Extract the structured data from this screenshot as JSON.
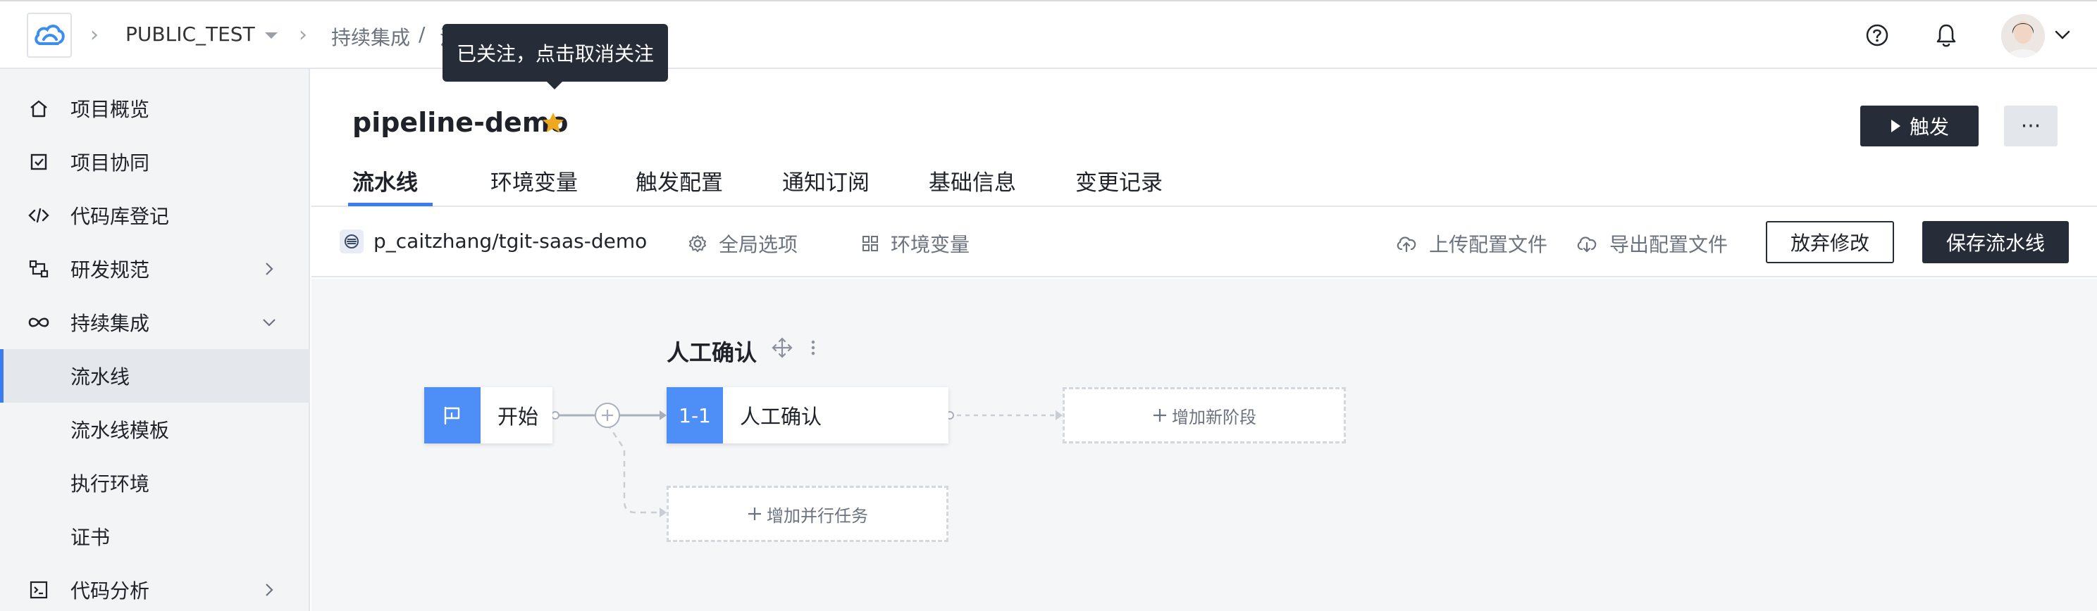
{
  "header": {
    "project": "PUBLIC_TEST",
    "breadcrumb_section": "持续集成",
    "breadcrumb_sep": "/",
    "breadcrumb_current": "流",
    "tooltip": "已关注，点击取消关注",
    "icons": [
      "help-icon",
      "bell-icon",
      "avatar",
      "chevron-down-icon"
    ]
  },
  "sidebar": {
    "items": [
      {
        "label": "项目概览",
        "icon": "home-icon"
      },
      {
        "label": "项目协同",
        "icon": "checkbox-icon"
      },
      {
        "label": "代码库登记",
        "icon": "code-icon"
      },
      {
        "label": "研发规范",
        "icon": "flow-icon",
        "expandable": true
      },
      {
        "label": "持续集成",
        "icon": "infinity-icon",
        "expanded": true
      },
      {
        "label": "流水线",
        "active": true
      },
      {
        "label": "流水线模板"
      },
      {
        "label": "执行环境"
      },
      {
        "label": "证书"
      },
      {
        "label": "代码分析",
        "icon": "terminal-icon",
        "expandable": true
      }
    ]
  },
  "pipeline": {
    "name": "pipeline-demo",
    "trigger_label": "触发",
    "more_label": "···",
    "tabs": [
      "流水线",
      "环境变量",
      "触发配置",
      "通知订阅",
      "基础信息",
      "变更记录"
    ],
    "active_tab": "流水线"
  },
  "toolbar": {
    "repo": "p_caitzhang/tgit-saas-demo",
    "global_options": "全局选项",
    "env_vars": "环境变量",
    "upload_config": "上传配置文件",
    "export_config": "导出配置文件",
    "discard": "放弃修改",
    "save": "保存流水线"
  },
  "canvas": {
    "stage_title": "人工确认",
    "start_label": "开始",
    "job_badge": "1-1",
    "job_label": "人工确认",
    "add_stage": "增加新阶段",
    "add_parallel": "增加并行任务"
  },
  "colors": {
    "accent": "#3b7cf0",
    "dark_button": "#272d38",
    "node_badge": "#4d8ef7",
    "star": "#f0a81e"
  }
}
